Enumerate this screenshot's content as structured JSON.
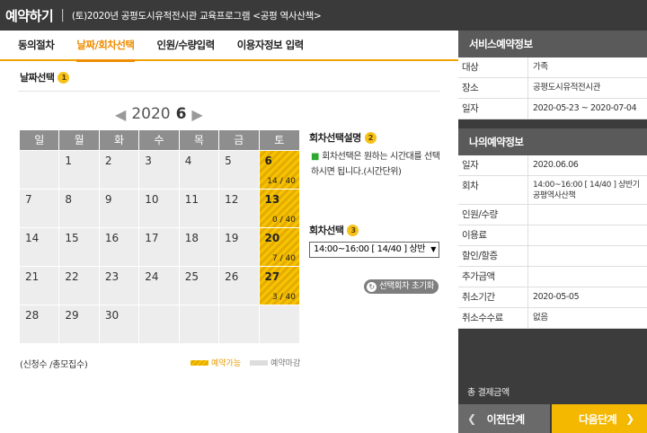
{
  "header": {
    "title": "예약하기",
    "subtitle": "(토)2020년 공평도시유적전시관 교육프로그램 <공평 역사산책>"
  },
  "steps": [
    {
      "label": "동의절차",
      "active": false
    },
    {
      "label": "날짜/회차선택",
      "active": true
    },
    {
      "label": "인원/수량입력",
      "active": false
    },
    {
      "label": "이용자정보 입력",
      "active": false
    }
  ],
  "date_select": {
    "label": "날짜선택",
    "badge": "1",
    "year": "2020",
    "month": "6",
    "prev_arrow": "◀",
    "next_arrow": "▶",
    "weekdays": [
      "일",
      "월",
      "화",
      "수",
      "목",
      "금",
      "토"
    ],
    "weeks": [
      [
        {
          "d": ""
        },
        {
          "d": "1"
        },
        {
          "d": "2"
        },
        {
          "d": "3"
        },
        {
          "d": "4"
        },
        {
          "d": "5"
        },
        {
          "d": "6",
          "cnt": "14 / 40",
          "avail": true
        }
      ],
      [
        {
          "d": "7"
        },
        {
          "d": "8"
        },
        {
          "d": "9"
        },
        {
          "d": "10"
        },
        {
          "d": "11"
        },
        {
          "d": "12"
        },
        {
          "d": "13",
          "cnt": "0 / 40",
          "avail": true
        }
      ],
      [
        {
          "d": "14"
        },
        {
          "d": "15"
        },
        {
          "d": "16"
        },
        {
          "d": "17"
        },
        {
          "d": "18"
        },
        {
          "d": "19"
        },
        {
          "d": "20",
          "cnt": "7 / 40",
          "avail": true
        }
      ],
      [
        {
          "d": "21"
        },
        {
          "d": "22"
        },
        {
          "d": "23"
        },
        {
          "d": "24"
        },
        {
          "d": "25"
        },
        {
          "d": "26"
        },
        {
          "d": "27",
          "cnt": "3 / 40",
          "avail": true
        }
      ],
      [
        {
          "d": "28"
        },
        {
          "d": "29"
        },
        {
          "d": "30"
        },
        {
          "d": ""
        },
        {
          "d": ""
        },
        {
          "d": ""
        },
        {
          "d": ""
        }
      ]
    ],
    "legend_left": "(신청수 /총모집수)",
    "legend_avail": "예약가능",
    "legend_closed": "예약마감"
  },
  "session_desc": {
    "label": "회차선택설명",
    "badge": "2",
    "text": "회차선택은 원하는 시간대를 선택하시면 됩니다.(시간단위)"
  },
  "session_select": {
    "label": "회차선택",
    "badge": "3",
    "value": "14:00~16:00 [ 14/40 ] 상반",
    "reset_label": "선택회차 초기화"
  },
  "service_info": {
    "title": "서비스예약정보",
    "rows": [
      {
        "k": "대상",
        "v": "가족"
      },
      {
        "k": "장소",
        "v": "공평도시유적전시관"
      },
      {
        "k": "일자",
        "v": "2020-05-23 ~ 2020-07-04"
      }
    ]
  },
  "my_info": {
    "title": "나의예약정보",
    "rows": [
      {
        "k": "일자",
        "v": "2020.06.06"
      },
      {
        "k": "회차",
        "v": "14:00~16:00 [ 14/40 ] 상반기 공평역사산책"
      },
      {
        "k": "인원/수량",
        "v": ""
      },
      {
        "k": "이용료",
        "v": ""
      },
      {
        "k": "할인/할증",
        "v": ""
      },
      {
        "k": "추가금액",
        "v": ""
      },
      {
        "k": "취소기간",
        "v": "2020-05-05"
      },
      {
        "k": "취소수수료",
        "v": "없음"
      }
    ]
  },
  "total_label": "총 결제금액",
  "buttons": {
    "prev": "이전단계",
    "next": "다음단계"
  }
}
